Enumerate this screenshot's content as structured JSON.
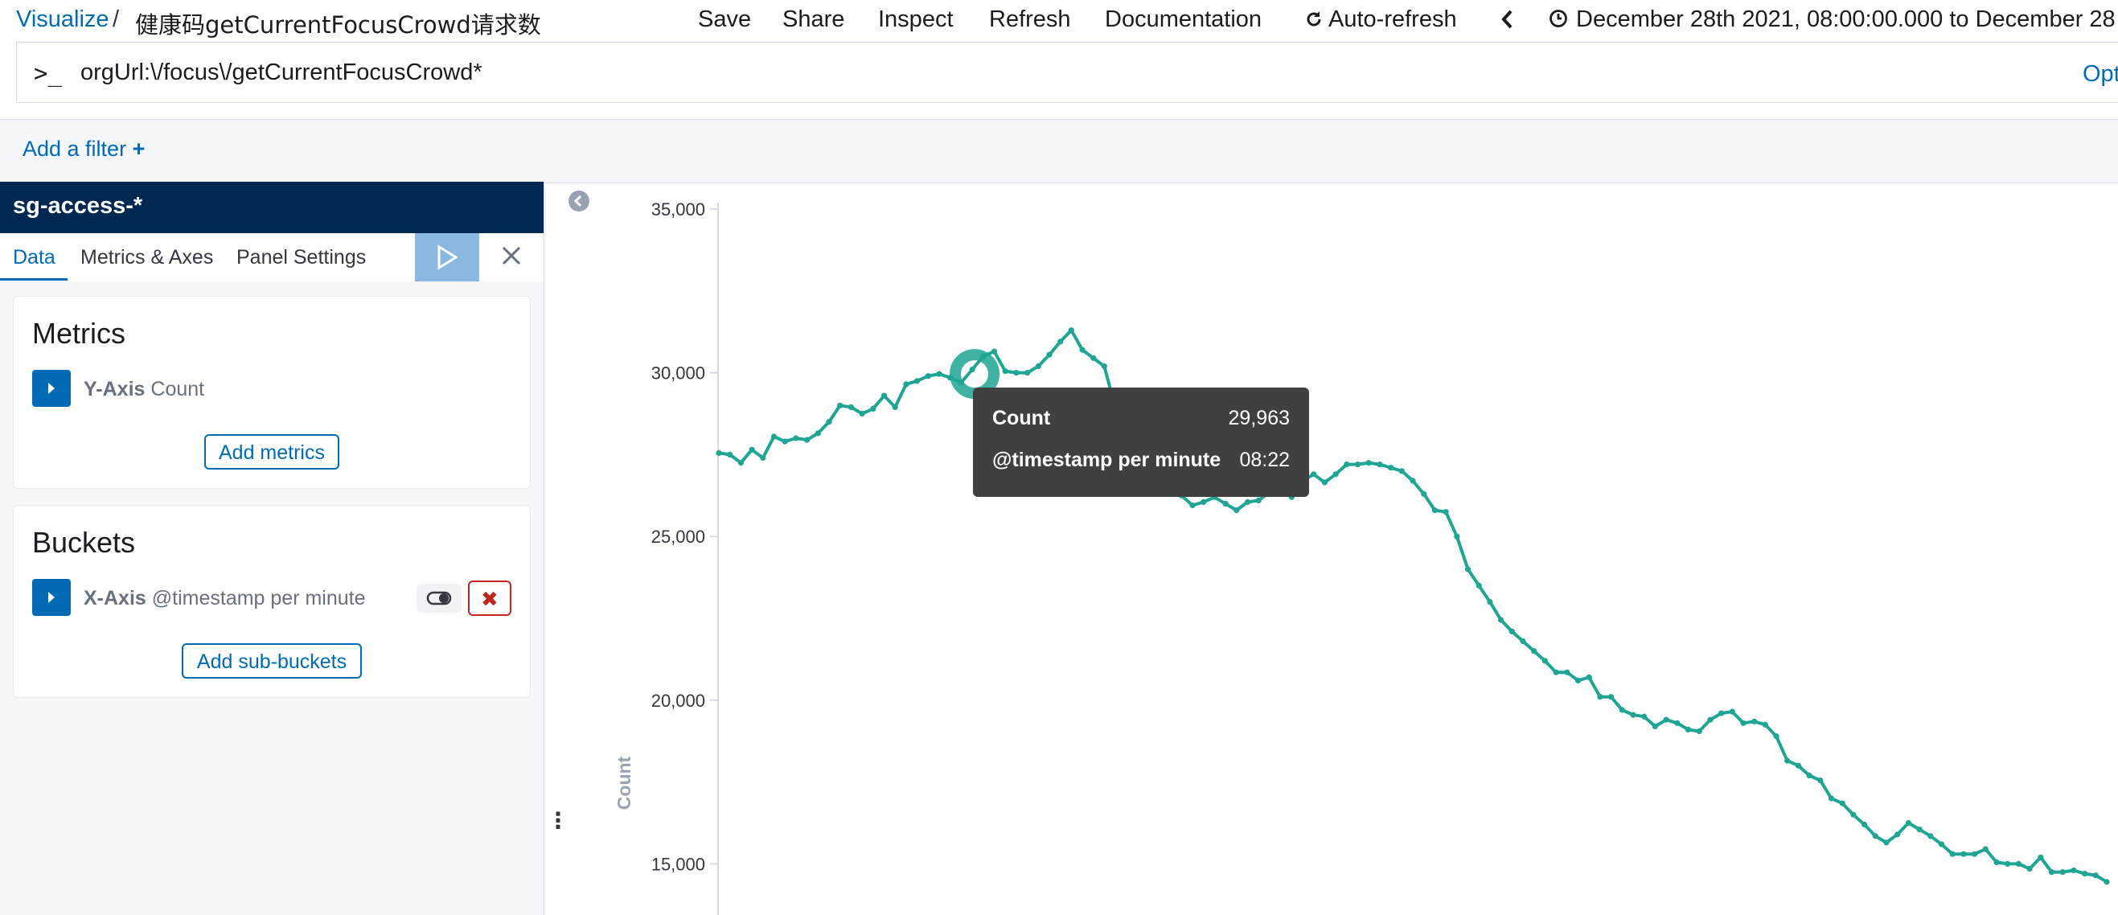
{
  "breadcrumb": {
    "root": "Visualize",
    "separator": "/",
    "title": "健康码getCurrentFocusCrowd请求数"
  },
  "top_nav": {
    "save": "Save",
    "share": "Share",
    "inspect": "Inspect",
    "refresh": "Refresh",
    "documentation": "Documentation",
    "auto_refresh": "Auto-refresh",
    "time_range": "December 28th 2021, 08:00:00.000 to December 28"
  },
  "query": {
    "prompt": ">_",
    "value": "orgUrl:\\/focus\\/getCurrentFocusCrowd*",
    "options_label": "Opt"
  },
  "filter": {
    "add_label": "Add a filter",
    "plus": "+"
  },
  "editor": {
    "index_pattern": "sg-access-*",
    "tabs": [
      "Data",
      "Metrics & Axes",
      "Panel Settings"
    ],
    "metrics": {
      "title": "Metrics",
      "axis": "Y-Axis",
      "agg": "Count",
      "add_button": "Add metrics"
    },
    "buckets": {
      "title": "Buckets",
      "axis": "X-Axis",
      "agg": "@timestamp per minute",
      "add_button": "Add sub-buckets",
      "remove_glyph": "✖"
    }
  },
  "tooltip": {
    "rows": [
      {
        "key": "Count",
        "value": "29,963"
      },
      {
        "key": "@timestamp per minute",
        "value": "08:22"
      }
    ]
  },
  "colors": {
    "line": "#1EA593",
    "accent": "#006BB4",
    "header": "#002850",
    "danger": "#BD271E"
  },
  "chart_data": {
    "type": "line",
    "ylabel": "Count",
    "ylim": [
      13000,
      35000
    ],
    "y_ticks": [
      "35,000",
      "30,000",
      "25,000",
      "20,000",
      "15,000"
    ],
    "y_tick_values": [
      35000,
      30000,
      25000,
      20000,
      15000
    ],
    "highlight_index": 15,
    "series": [
      {
        "name": "Count",
        "values": [
          27550,
          27500,
          27250,
          27650,
          27400,
          28050,
          27900,
          28000,
          27950,
          28150,
          28500,
          29000,
          28950,
          28750,
          28900,
          29300,
          28950,
          29650,
          29750,
          29900,
          29963,
          29850,
          29700,
          30100,
          30500,
          30650,
          30050,
          30000,
          30000,
          30200,
          30550,
          30950,
          31300,
          30700,
          30450,
          30200,
          28900,
          27600,
          26950,
          26800,
          26600,
          26400,
          26250,
          25950,
          26050,
          26200,
          26000,
          25800,
          26050,
          26100,
          26350,
          26450,
          26200,
          26700,
          26900,
          26650,
          26900,
          27200,
          27200,
          27250,
          27200,
          27100,
          27000,
          26700,
          26300,
          25800,
          25750,
          25000,
          24000,
          23500,
          23000,
          22450,
          22100,
          21800,
          21500,
          21200,
          20850,
          20850,
          20600,
          20700,
          20100,
          20100,
          19700,
          19550,
          19500,
          19200,
          19400,
          19300,
          19100,
          19050,
          19400,
          19600,
          19650,
          19300,
          19350,
          19250,
          18900,
          18150,
          18000,
          17700,
          17550,
          17000,
          16850,
          16500,
          16200,
          15850,
          15650,
          15900,
          16250,
          16050,
          15850,
          15600,
          15300,
          15300,
          15300,
          15450,
          15050,
          15000,
          15000,
          14850,
          15200,
          14750,
          14750,
          14800,
          14700,
          14650,
          14450
        ]
      }
    ]
  }
}
